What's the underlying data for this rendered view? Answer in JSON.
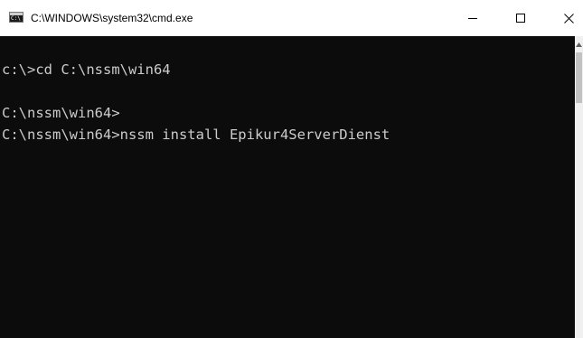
{
  "window": {
    "title": "C:\\WINDOWS\\system32\\cmd.exe",
    "icon": "cmd-icon",
    "icon_label": "C:\\",
    "controls": {
      "minimize_icon": "minimize-icon",
      "maximize_icon": "maximize-icon",
      "close_icon": "close-icon"
    }
  },
  "console": {
    "background": "#0c0c0c",
    "foreground": "#cccccc",
    "lines": [
      "c:\\>cd C:\\nssm\\win64",
      "",
      "C:\\nssm\\win64>",
      "C:\\nssm\\win64>nssm install Epikur4ServerDienst"
    ]
  },
  "scrollbar": {
    "up_arrow_icon": "scroll-up-arrow-icon"
  }
}
